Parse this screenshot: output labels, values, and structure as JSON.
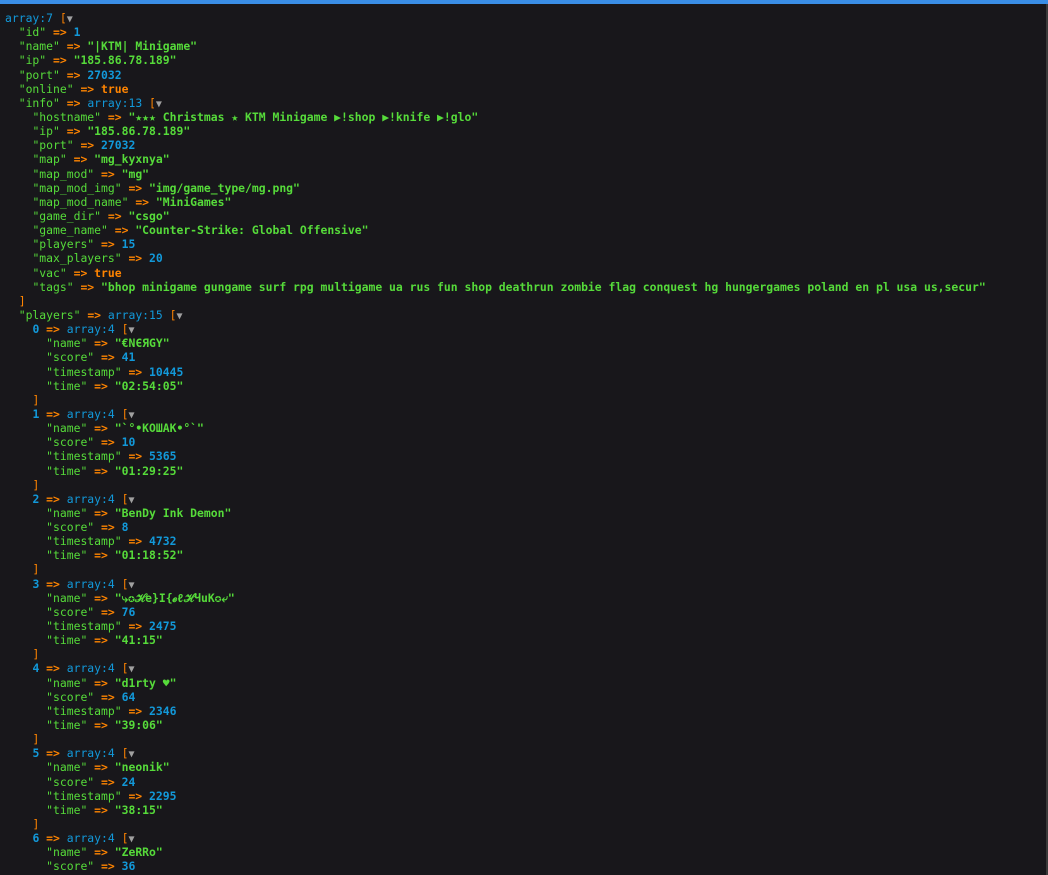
{
  "root": {
    "label": "array:7"
  },
  "top": [
    {
      "key": "\"id\"",
      "value": "1",
      "type": "num"
    },
    {
      "key": "\"name\"",
      "value": "\"|KTM| Minigame\"",
      "type": "str"
    },
    {
      "key": "\"ip\"",
      "value": "\"185.86.78.189\"",
      "type": "str"
    },
    {
      "key": "\"port\"",
      "value": "27032",
      "type": "num"
    },
    {
      "key": "\"online\"",
      "value": "true",
      "type": "bool"
    }
  ],
  "info": {
    "key": "\"info\"",
    "label": "array:13",
    "rows": [
      {
        "key": "\"hostname\"",
        "value": "\"★★★ Christmas ★ KTM Minigame ▶!shop ▶!knife ▶!glo\"",
        "type": "str"
      },
      {
        "key": "\"ip\"",
        "value": "\"185.86.78.189\"",
        "type": "str"
      },
      {
        "key": "\"port\"",
        "value": "27032",
        "type": "num"
      },
      {
        "key": "\"map\"",
        "value": "\"mg_kyxnya\"",
        "type": "str"
      },
      {
        "key": "\"map_mod\"",
        "value": "\"mg\"",
        "type": "str"
      },
      {
        "key": "\"map_mod_img\"",
        "value": "\"img/game_type/mg.png\"",
        "type": "str"
      },
      {
        "key": "\"map_mod_name\"",
        "value": "\"MiniGames\"",
        "type": "str"
      },
      {
        "key": "\"game_dir\"",
        "value": "\"csgo\"",
        "type": "str"
      },
      {
        "key": "\"game_name\"",
        "value": "\"Counter-Strike: Global Offensive\"",
        "type": "str"
      },
      {
        "key": "\"players\"",
        "value": "15",
        "type": "num"
      },
      {
        "key": "\"max_players\"",
        "value": "20",
        "type": "num"
      },
      {
        "key": "\"vac\"",
        "value": "true",
        "type": "bool"
      },
      {
        "key": "\"tags\"",
        "value": "\"bhop minigame gungame surf rpg multigame ua rus fun shop deathrun zombie flag conquest hg hungergames poland en pl usa us,secur\"",
        "type": "str"
      }
    ]
  },
  "players": {
    "key": "\"players\"",
    "label": "array:15",
    "item_label": "array:4",
    "items": [
      {
        "index": "0",
        "name": "\"€NЄЯGY\"",
        "score": "41",
        "timestamp": "10445",
        "time": "\"02:54:05\""
      },
      {
        "index": "1",
        "name": "\"`°•KОШАК•°`\"",
        "score": "10",
        "timestamp": "5365",
        "time": "\"01:29:25\""
      },
      {
        "index": "2",
        "name": "\"BenDy Ink Demon\"",
        "score": "8",
        "timestamp": "4732",
        "time": "\"01:18:52\""
      },
      {
        "index": "3",
        "name": "\"⤷✪ℋe}I{ℯℓℋЧuК✪⤶\"",
        "score": "76",
        "timestamp": "2475",
        "time": "\"41:15\""
      },
      {
        "index": "4",
        "name": "\"d1rty ♥\"",
        "score": "64",
        "timestamp": "2346",
        "time": "\"39:06\""
      },
      {
        "index": "5",
        "name": "\"neonik\"",
        "score": "24",
        "timestamp": "2295",
        "time": "\"38:15\""
      },
      {
        "index": "6",
        "name": "\"ZeRRo\"",
        "score": "36",
        "timestamp": "",
        "time": ""
      }
    ]
  },
  "field_keys": {
    "name": "\"name\"",
    "score": "\"score\"",
    "timestamp": "\"timestamp\"",
    "time": "\"time\""
  },
  "syntax": {
    "arrow": "=>",
    "open": "[",
    "close": "]",
    "toggle": "▼"
  }
}
